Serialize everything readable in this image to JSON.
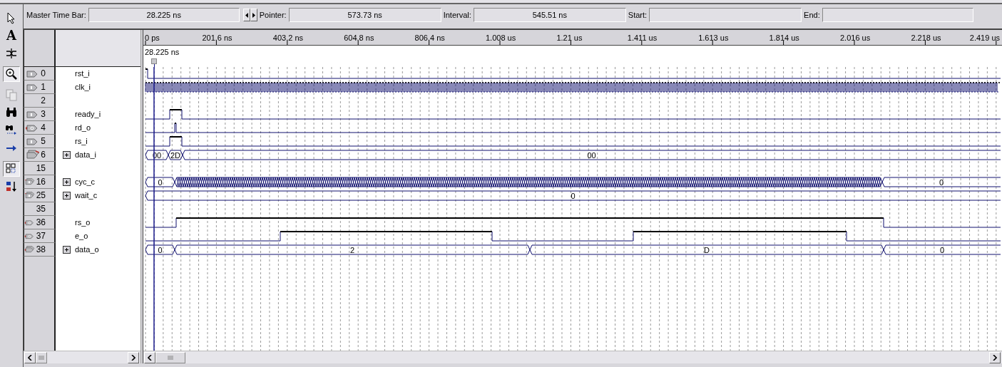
{
  "toolbar": [
    {
      "kind": "pointer",
      "selected": false,
      "disabled": false
    },
    {
      "kind": "text",
      "glyph": "A",
      "selected": false,
      "disabled": false
    },
    {
      "kind": "waveform-edit",
      "selected": false,
      "disabled": false
    },
    {
      "kind": "zoom",
      "selected": true,
      "disabled": false
    },
    {
      "kind": "copy",
      "selected": false,
      "disabled": true
    },
    {
      "kind": "find",
      "selected": false,
      "disabled": false
    },
    {
      "kind": "find-next",
      "selected": false,
      "disabled": false
    },
    {
      "kind": "replace",
      "selected": false,
      "disabled": false
    },
    {
      "kind": "snap",
      "selected": true,
      "disabled": false
    },
    {
      "kind": "sort",
      "selected": false,
      "disabled": false
    }
  ],
  "time_bar": {
    "master_label": "Master Time Bar:",
    "master_value": "28.225 ns",
    "pointer_label": "Pointer:",
    "pointer_value": "573.73 ns",
    "interval_label": "Interval:",
    "interval_value": "545.51 ns",
    "start_label": "Start:",
    "end_label": "End:"
  },
  "ruler": [
    "0 ps",
    "201.6 ns",
    "403.2 ns",
    "604.8 ns",
    "806.4 ns",
    "1.008 us",
    "1.21 us",
    "1.411 us",
    "1.613 us",
    "1.814 us",
    "2.016 us",
    "2.218 us",
    "2.419 us"
  ],
  "cursor_label": "28.225 ns",
  "rows": [
    {
      "index": "0",
      "pin": {
        "kind": "in"
      },
      "name": "rst_i",
      "kind": "bit"
    },
    {
      "index": "1",
      "pin": {
        "kind": "in"
      },
      "name": "clk_i",
      "kind": "clock"
    },
    {
      "index": "2",
      "kind": "blank"
    },
    {
      "index": "3",
      "pin": {
        "kind": "in"
      },
      "name": "ready_i",
      "kind": "bit"
    },
    {
      "index": "4",
      "pin": {
        "kind": "out"
      },
      "name": "rd_o",
      "kind": "bit"
    },
    {
      "index": "5",
      "pin": {
        "kind": "in"
      },
      "name": "rs_i",
      "kind": "bit"
    },
    {
      "index": "6",
      "pin": {
        "kind": "in-bus"
      },
      "name": "data_i",
      "kind": "bus",
      "expanded": false,
      "segments": [
        {
          "label": "00"
        },
        {
          "label": "2D"
        },
        {
          "label": "00"
        }
      ]
    },
    {
      "index": "15",
      "kind": "blank"
    },
    {
      "index": "16",
      "pin": {
        "kind": "reg-bus"
      },
      "name": "cyc_c",
      "kind": "bus",
      "expanded": false,
      "segments": [
        {
          "label": "0"
        },
        {
          "kind": "toggling"
        },
        {
          "label": "0"
        }
      ]
    },
    {
      "index": "25",
      "pin": {
        "kind": "reg-bus"
      },
      "name": "wait_c",
      "kind": "bus",
      "expanded": false,
      "segments": [
        {
          "label": "0"
        }
      ]
    },
    {
      "index": "35",
      "kind": "blank"
    },
    {
      "index": "36",
      "pin": {
        "kind": "out"
      },
      "name": "rs_o",
      "kind": "bit"
    },
    {
      "index": "37",
      "pin": {
        "kind": "out"
      },
      "name": "e_o",
      "kind": "bit"
    },
    {
      "index": "38",
      "pin": {
        "kind": "out-bus"
      },
      "name": "data_o",
      "kind": "bus",
      "expanded": false,
      "segments": [
        {
          "label": "0"
        },
        {
          "label": "2"
        },
        {
          "label": "D"
        },
        {
          "label": "0"
        }
      ]
    }
  ]
}
